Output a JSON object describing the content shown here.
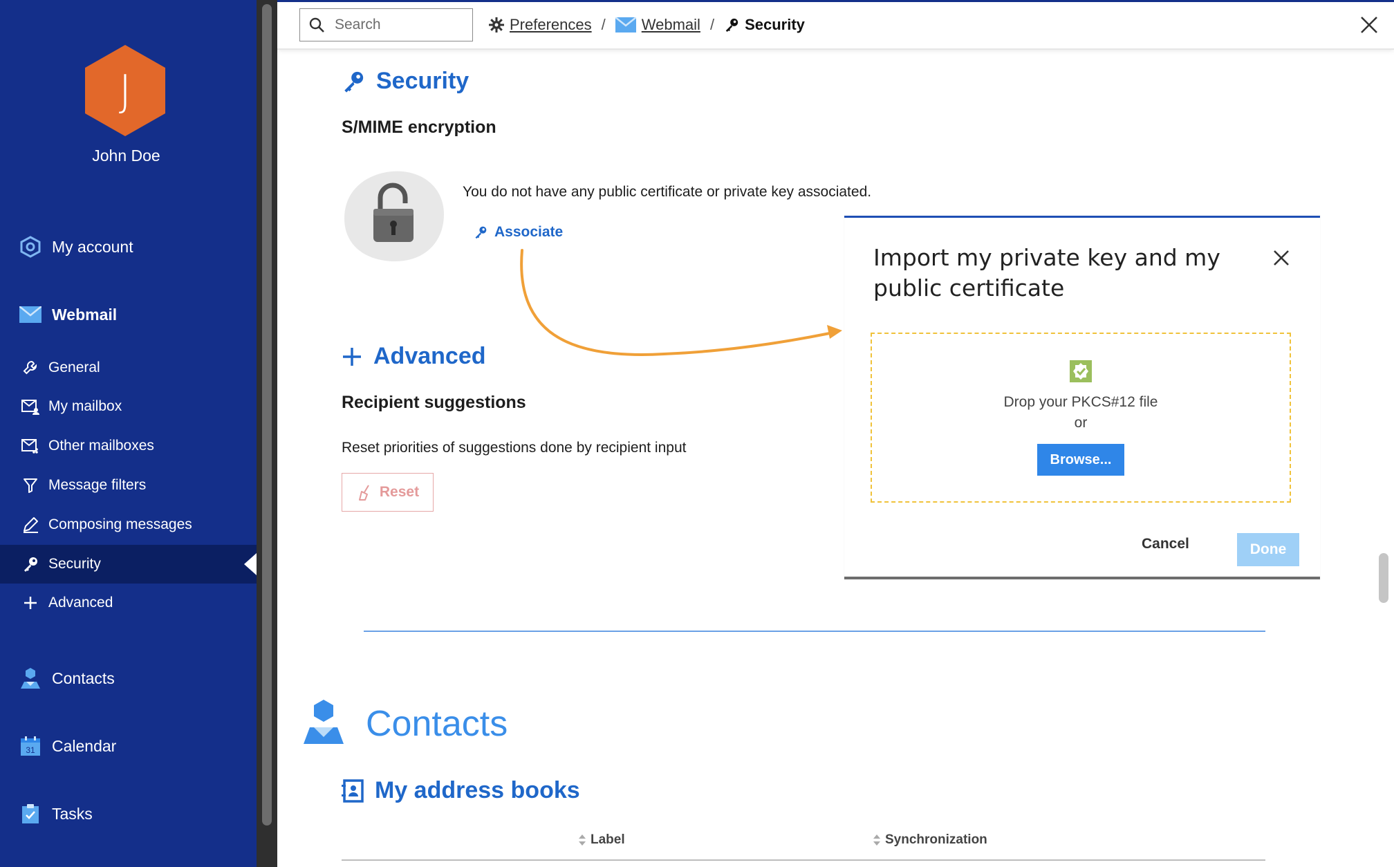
{
  "user": {
    "initial": "J",
    "name": "John Doe"
  },
  "colors": {
    "sidebar_bg": "#142f8a",
    "sidebar_active": "#0b1f62",
    "accent": "#1f67c9",
    "avatar": "#e2682a",
    "arrow": "#f0a038",
    "dropzone_border": "#f0c23a",
    "browse": "#2f86e8",
    "done_disabled": "#9fd0f7",
    "reset": "#e49a9a"
  },
  "sidebar": {
    "items": [
      {
        "label": "My account",
        "icon": "account-hexagon-icon"
      },
      {
        "label": "Webmail",
        "icon": "mail-icon"
      },
      {
        "label": "General",
        "icon": "wrench-icon"
      },
      {
        "label": "My mailbox",
        "icon": "mailbox-user-icon"
      },
      {
        "label": "Other mailboxes",
        "icon": "mailboxes-icon"
      },
      {
        "label": "Message filters",
        "icon": "filter-icon"
      },
      {
        "label": "Composing messages",
        "icon": "pencil-icon"
      },
      {
        "label": "Security",
        "icon": "key-icon"
      },
      {
        "label": "Advanced",
        "icon": "plus-icon"
      },
      {
        "label": "Contacts",
        "icon": "contact-icon"
      },
      {
        "label": "Calendar",
        "icon": "calendar-icon",
        "day": "31"
      },
      {
        "label": "Tasks",
        "icon": "tasks-icon"
      }
    ]
  },
  "topbar": {
    "search_placeholder": "Search",
    "breadcrumbs": [
      {
        "label": "Preferences",
        "icon": "gear-icon"
      },
      {
        "label": "Webmail",
        "icon": "mail-icon"
      },
      {
        "label": "Security",
        "icon": "key-icon"
      }
    ],
    "separator": "/"
  },
  "main": {
    "security_title": "Security",
    "smime_title": "S/MIME encryption",
    "no_cert_text": "You do not have any public certificate or private key associated.",
    "associate_label": "Associate",
    "advanced_title": "Advanced",
    "recipient_title": "Recipient suggestions",
    "reset_desc": "Reset priorities of suggestions done by recipient input",
    "reset_label": "Reset",
    "contacts_title": "Contacts",
    "address_books_title": "My address books",
    "table_headers": [
      "Label",
      "Synchronization"
    ]
  },
  "modal": {
    "title": "Import my private key and my public certificate",
    "drop_text": "Drop your PKCS#12 file",
    "or_text": "or",
    "browse_label": "Browse...",
    "cancel_label": "Cancel",
    "done_label": "Done"
  }
}
